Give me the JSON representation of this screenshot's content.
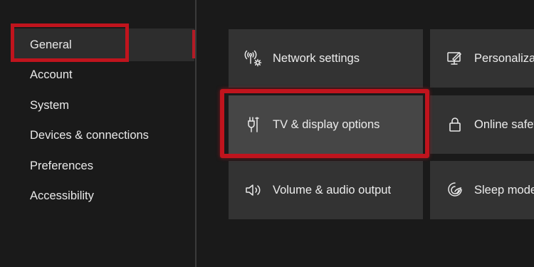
{
  "nav": {
    "items": [
      {
        "label": "General"
      },
      {
        "label": "Account"
      },
      {
        "label": "System"
      },
      {
        "label": "Devices & connections"
      },
      {
        "label": "Preferences"
      },
      {
        "label": "Accessibility"
      }
    ],
    "selected": "General"
  },
  "tiles": [
    {
      "label": "Network settings",
      "icon": "network-icon"
    },
    {
      "label": "Personalization",
      "icon": "personalization-icon"
    },
    {
      "label": "TV & display options",
      "icon": "tv-display-icon",
      "focused": true
    },
    {
      "label": "Online safety",
      "icon": "lock-icon"
    },
    {
      "label": "Volume & audio output",
      "icon": "speaker-icon"
    },
    {
      "label": "Sleep mode",
      "icon": "sleep-mode-icon"
    }
  ],
  "colors": {
    "background": "#1a1a1a",
    "tile": "#333333",
    "tile_focused": "#464646",
    "highlight_red": "#c0141d",
    "accent_red": "#b31b25"
  }
}
